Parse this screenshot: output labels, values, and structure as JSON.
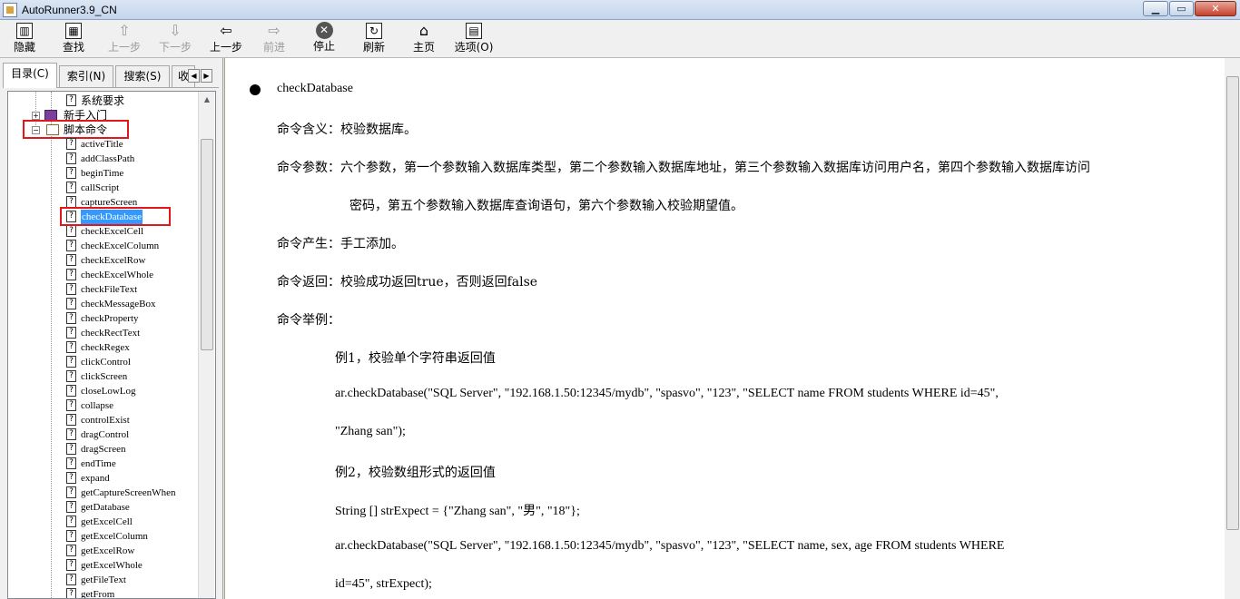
{
  "window": {
    "title": "AutoRunner3.9_CN",
    "minimize": "▁",
    "maximize": "▭",
    "close": "✕"
  },
  "toolbar": {
    "hide": "隐藏",
    "find": "查找",
    "prev": "上一步",
    "next": "下一步",
    "back": "上一步",
    "forward": "前进",
    "stop": "停止",
    "refresh": "刷新",
    "home": "主页",
    "options": "选项(O)"
  },
  "tabs": {
    "contents": "目录(C)",
    "index": "索引(N)",
    "search": "搜索(S)",
    "favorites": "收"
  },
  "tree": {
    "top_items": [
      "系统要求",
      "新手入门",
      "脚本命令"
    ],
    "commands": [
      "activeTitle",
      "addClassPath",
      "beginTime",
      "callScript",
      "captureScreen",
      "checkDatabase",
      "checkExcelCell",
      "checkExcelColumn",
      "checkExcelRow",
      "checkExcelWhole",
      "checkFileText",
      "checkMessageBox",
      "checkProperty",
      "checkRectText",
      "checkRegex",
      "clickControl",
      "clickScreen",
      "closeLowLog",
      "collapse",
      "controlExist",
      "dragControl",
      "dragScreen",
      "endTime",
      "expand",
      "getCaptureScreenWhen",
      "getDatabase",
      "getExcelCell",
      "getExcelColumn",
      "getExcelRow",
      "getExcelWhole",
      "getFileText",
      "getFrom"
    ],
    "selected": "checkDatabase"
  },
  "content": {
    "heading": "checkDatabase",
    "meaning": "命令含义：校验数据库。",
    "params_line1": "命令参数：六个参数，第一个参数输入数据库类型，第二个参数输入数据库地址，第三个参数输入数据库访问用户名，第四个参数输入数据库访问",
    "params_line2": "密码，第五个参数输入数据库查询语句，第六个参数输入校验期望值。",
    "origin": "命令产生：手工添加。",
    "returns": "命令返回：校验成功返回true，否则返回false",
    "example_title": "命令举例：",
    "ex1_title": "例1，校验单个字符串返回值",
    "ex1_code1": "ar.checkDatabase(\"SQL  Server\",  \"192.168.1.50:12345/mydb\",  \"spasvo\",  \"123\",  \"SELECT  name  FROM  students  WHERE  id=45\",",
    "ex1_code2": "\"Zhang san\");",
    "ex2_title": "例2，校验数组形式的返回值",
    "ex2_code1": "String [] strExpect = {\"Zhang san\", \"男\", \"18\"};",
    "ex2_code2": "ar.checkDatabase(\"SQL  Server\",  \"192.168.1.50:12345/mydb\",  \"spasvo\",  \"123\",  \"SELECT  name,  sex,  age  FROM  students  WHERE",
    "ex2_code3": "id=45\", strExpect);"
  }
}
